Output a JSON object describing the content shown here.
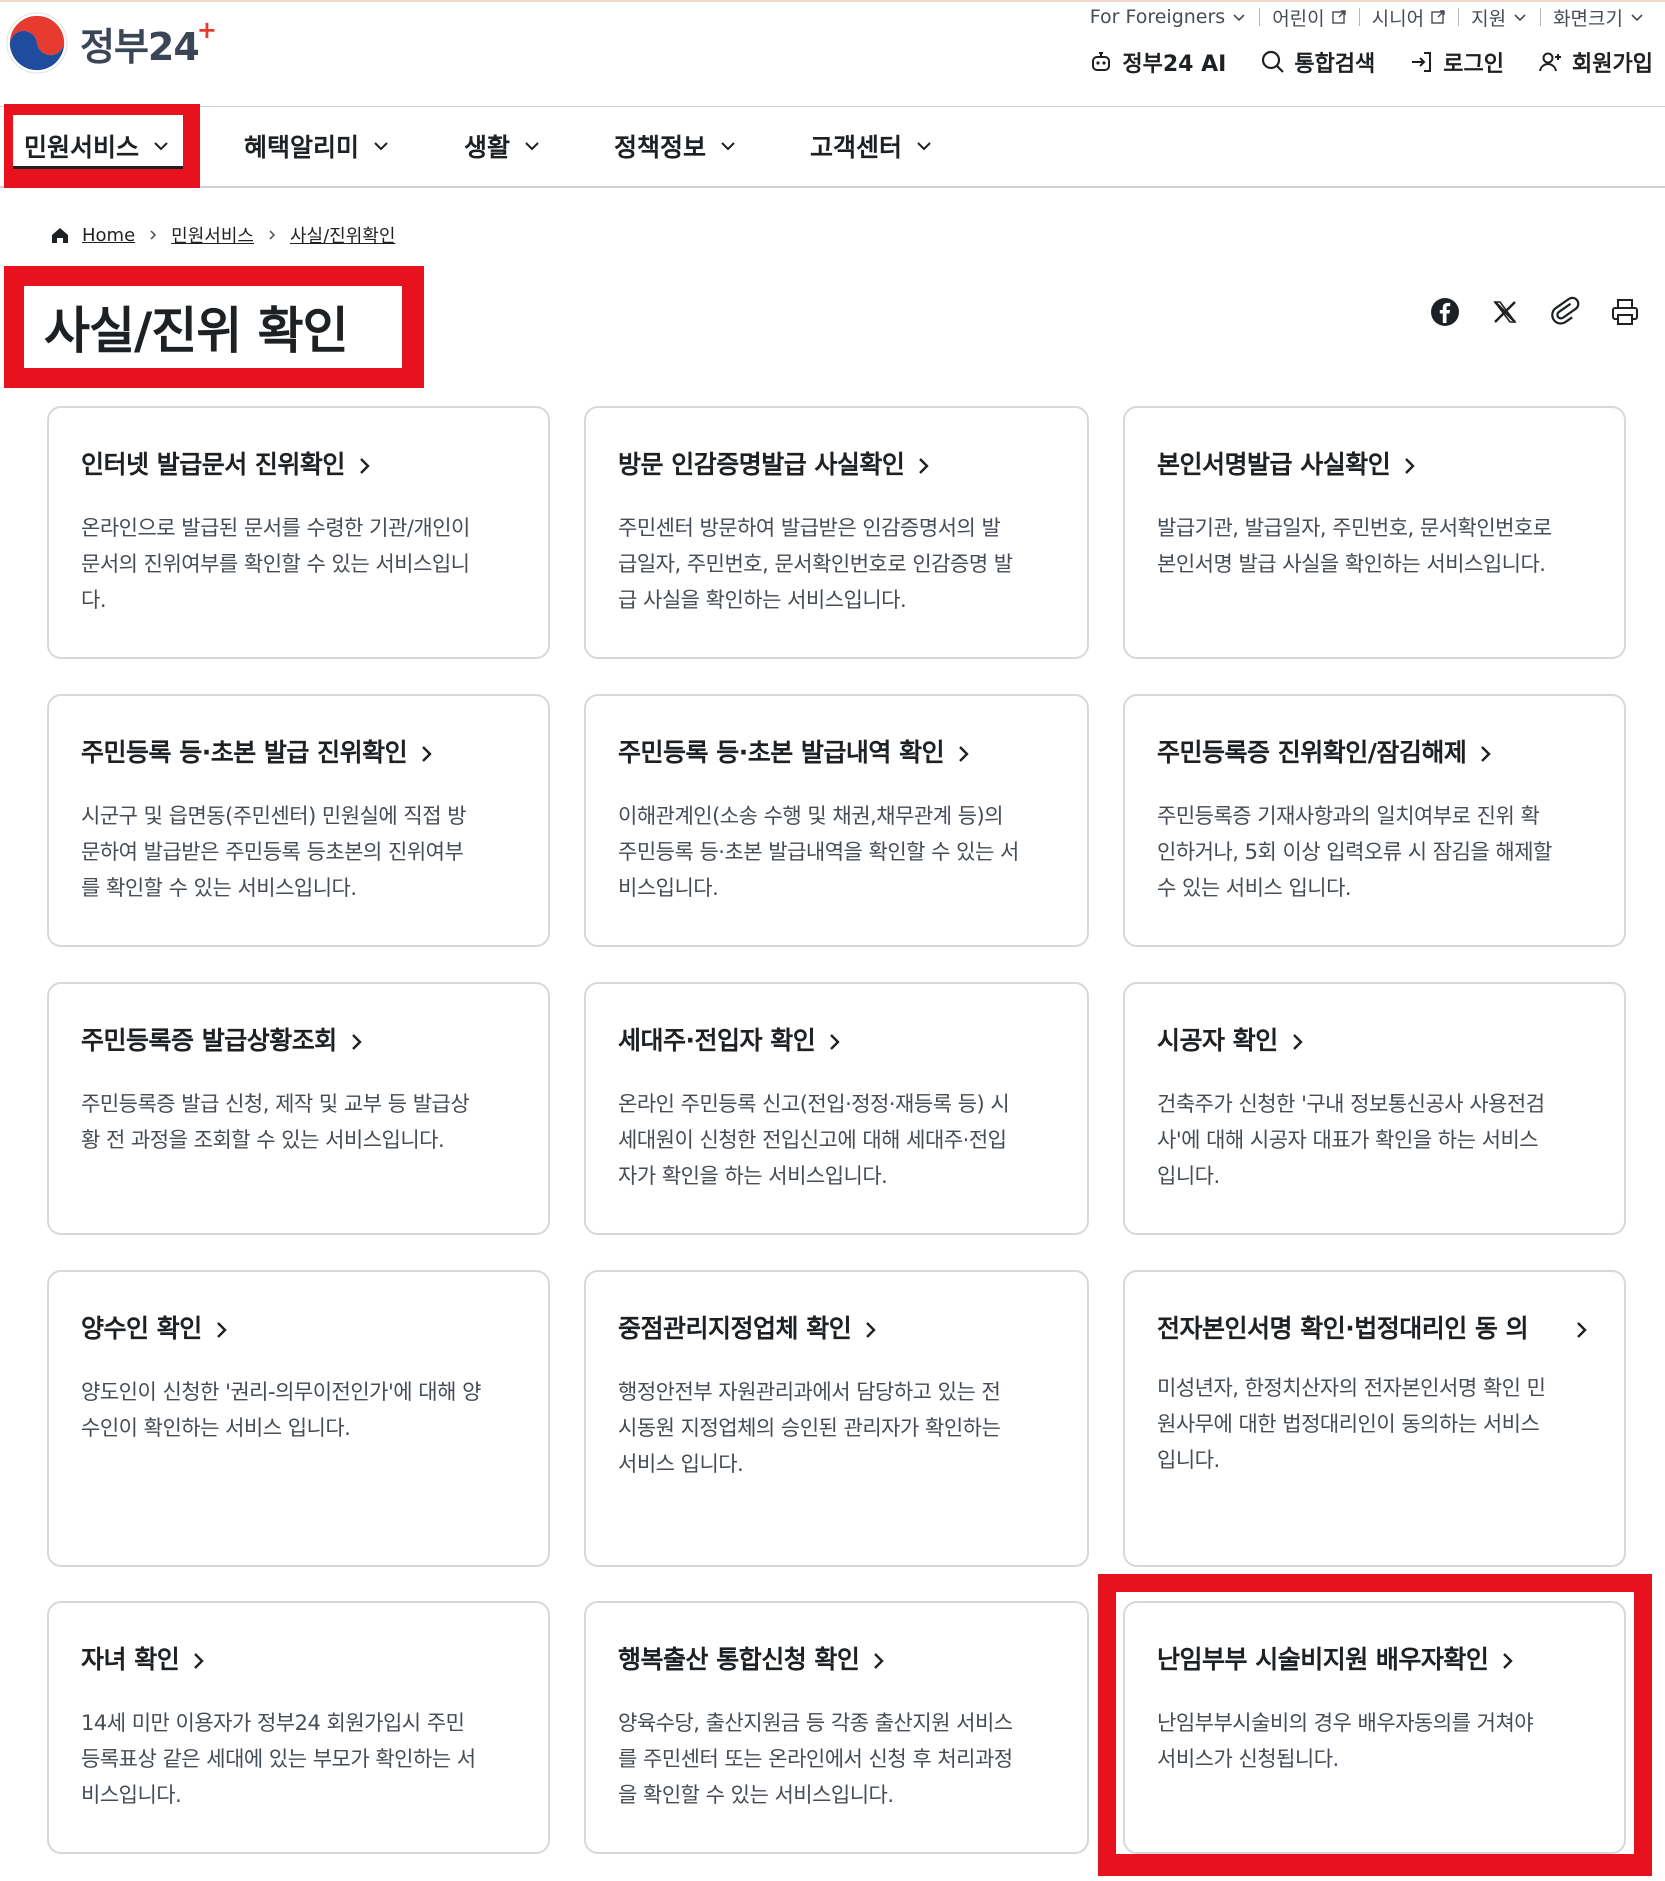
{
  "header": {
    "logo_text": "정부",
    "logo_num": "24",
    "util": [
      {
        "label": "For Foreigners",
        "icon": "chevron-down-icon"
      },
      {
        "label": "어린이",
        "icon": "external-link-icon"
      },
      {
        "label": "시니어",
        "icon": "external-link-icon"
      },
      {
        "label": "지원",
        "icon": "chevron-down-icon"
      },
      {
        "label": "화면크기",
        "icon": "chevron-down-icon"
      }
    ],
    "actions": [
      {
        "label": "정부24 AI",
        "icon": "robot-icon"
      },
      {
        "label": "통합검색",
        "icon": "search-icon"
      },
      {
        "label": "로그인",
        "icon": "login-icon"
      },
      {
        "label": "회원가입",
        "icon": "user-plus-icon"
      }
    ]
  },
  "gnb": [
    "민원서비스",
    "혜택알리미",
    "생활",
    "정책정보",
    "고객센터"
  ],
  "breadcrumb": [
    "Home",
    "민원서비스",
    "사실/진위확인"
  ],
  "page": {
    "title": "사실/진위 확인"
  },
  "share_icons": [
    "facebook-icon",
    "x-icon",
    "link-icon",
    "print-icon"
  ],
  "highlight_color": "#e8121f",
  "cards": [
    {
      "title": "인터넷 발급문서 진위확인",
      "desc": [
        "온라인으로 발급된 문서를 수령한 기관/개인이",
        "문서의 진위여부를 확인할 수 있는 서비스입니",
        "다."
      ]
    },
    {
      "title": "방문 인감증명발급 사실확인",
      "desc": [
        "주민센터 방문하여 발급받은 인감증명서의 발",
        "급일자, 주민번호, 문서확인번호로 인감증명 발",
        "급 사실을 확인하는 서비스입니다."
      ]
    },
    {
      "title": "본인서명발급 사실확인",
      "desc": [
        "발급기관, 발급일자, 주민번호, 문서확인번호로",
        "본인서명 발급 사실을 확인하는 서비스입니다."
      ]
    },
    {
      "title": "주민등록 등·초본 발급 진위확인",
      "desc": [
        "시군구 및 읍면동(주민센터) 민원실에 직접 방",
        "문하여 발급받은 주민등록 등초본의 진위여부",
        "를 확인할 수 있는 서비스입니다."
      ]
    },
    {
      "title": "주민등록 등·초본 발급내역 확인",
      "desc": [
        "이해관계인(소송 수행 및 채권,채무관계 등)의",
        "주민등록 등·초본 발급내역을 확인할 수 있는 서",
        "비스입니다."
      ]
    },
    {
      "title": "주민등록증 진위확인/잠김해제",
      "desc": [
        "주민등록증 기재사항과의 일치여부로 진위 확",
        "인하거나, 5회 이상 입력오류 시 잠김을 해제할",
        "수 있는 서비스 입니다."
      ]
    },
    {
      "title": "주민등록증 발급상황조회",
      "desc": [
        "주민등록증 발급 신청, 제작 및 교부 등 발급상",
        "황 전 과정을 조회할 수 있는 서비스입니다."
      ]
    },
    {
      "title": "세대주·전입자 확인",
      "desc": [
        "온라인 주민등록 신고(전입·정정·재등록 등) 시",
        "세대원이 신청한 전입신고에 대해 세대주·전입",
        "자가 확인을 하는 서비스입니다."
      ]
    },
    {
      "title": "시공자 확인",
      "desc": [
        "건축주가 신청한 '구내 정보통신공사 사용전검",
        "사'에 대해 시공자 대표가 확인을 하는 서비스",
        "입니다."
      ]
    },
    {
      "title": "양수인 확인",
      "desc": [
        "양도인이 신청한 '권리-의무이전인가'에 대해 양",
        "수인이 확인하는 서비스 입니다."
      ]
    },
    {
      "title": "중점관리지정업체 확인",
      "desc": [
        "행정안전부 자원관리과에서 담당하고 있는 전",
        "시동원 지정업체의 승인된 관리자가 확인하는",
        "서비스 입니다."
      ]
    },
    {
      "title_lines": [
        "전자본인서명 확인·법정대리인 동",
        "의"
      ],
      "desc": [
        "미성년자, 한정치산자의 전자본인서명 확인 민",
        "원사무에 대한 법정대리인이 동의하는 서비스",
        "입니다."
      ]
    },
    {
      "title": "자녀 확인",
      "desc": [
        "14세 미만 이용자가 정부24 회원가입시 주민",
        "등록표상 같은 세대에 있는 부모가 확인하는 서",
        "비스입니다."
      ]
    },
    {
      "title": "행복출산 통합신청 확인",
      "desc": [
        "양육수당, 출산지원금 등 각종 출산지원 서비스",
        "를 주민센터 또는 온라인에서 신청 후 처리과정",
        "을 확인할 수 있는 서비스입니다."
      ]
    },
    {
      "title": "난임부부 시술비지원 배우자확인",
      "desc": [
        "난임부부시술비의 경우 배우자동의를 거쳐야",
        "서비스가 신청됩니다."
      ]
    }
  ]
}
